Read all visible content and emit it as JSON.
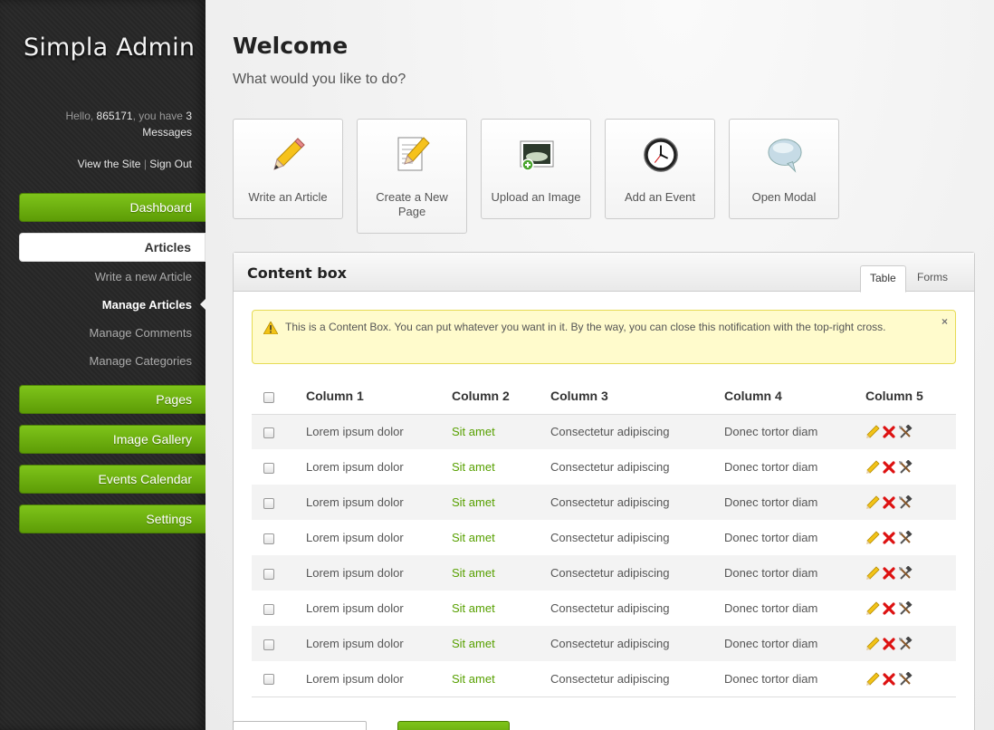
{
  "sidebar": {
    "logo": "Simpla Admin",
    "profile": {
      "hello": "Hello,",
      "username": "865171",
      "you_have": ", you have",
      "count": "3",
      "messages": "Messages"
    },
    "links": {
      "view_site": "View the Site",
      "separator": "|",
      "sign_out": "Sign Out"
    },
    "nav": [
      {
        "label": "Dashboard"
      },
      {
        "label": "Articles",
        "current": true
      },
      {
        "label": "Pages"
      },
      {
        "label": "Image Gallery"
      },
      {
        "label": "Events Calendar"
      },
      {
        "label": "Settings"
      }
    ],
    "subnav": [
      {
        "label": "Write a new Article"
      },
      {
        "label": "Manage Articles",
        "current": true
      },
      {
        "label": "Manage Comments"
      },
      {
        "label": "Manage Categories"
      }
    ]
  },
  "main": {
    "title": "Welcome",
    "subtitle": "What would you like to do?",
    "shortcuts": [
      {
        "label": "Write an Article",
        "icon": "pencil-icon"
      },
      {
        "label": "Create a New Page",
        "icon": "page-edit-icon"
      },
      {
        "label": "Upload an Image",
        "icon": "image-upload-icon"
      },
      {
        "label": "Add an Event",
        "icon": "clock-icon"
      },
      {
        "label": "Open Modal",
        "icon": "speech-bubble-icon"
      }
    ],
    "content_box": {
      "title": "Content box",
      "tabs": [
        "Table",
        "Forms"
      ],
      "active_tab": "Table",
      "notice": "This is a Content Box. You can put whatever you want in it. By the way, you can close this notification with the top-right cross.",
      "notice_close": "×",
      "columns": [
        "Column 1",
        "Column 2",
        "Column 3",
        "Column 4",
        "Column 5"
      ],
      "rows": [
        [
          "Lorem ipsum dolor",
          "Sit amet",
          "Consectetur adipiscing",
          "Donec tortor diam"
        ],
        [
          "Lorem ipsum dolor",
          "Sit amet",
          "Consectetur adipiscing",
          "Donec tortor diam"
        ],
        [
          "Lorem ipsum dolor",
          "Sit amet",
          "Consectetur adipiscing",
          "Donec tortor diam"
        ],
        [
          "Lorem ipsum dolor",
          "Sit amet",
          "Consectetur adipiscing",
          "Donec tortor diam"
        ],
        [
          "Lorem ipsum dolor",
          "Sit amet",
          "Consectetur adipiscing",
          "Donec tortor diam"
        ],
        [
          "Lorem ipsum dolor",
          "Sit amet",
          "Consectetur adipiscing",
          "Donec tortor diam"
        ],
        [
          "Lorem ipsum dolor",
          "Sit amet",
          "Consectetur adipiscing",
          "Donec tortor diam"
        ],
        [
          "Lorem ipsum dolor",
          "Sit amet",
          "Consectetur adipiscing",
          "Donec tortor diam"
        ]
      ],
      "row_actions": [
        "edit-icon",
        "delete-icon",
        "tools-icon"
      ]
    }
  },
  "colors": {
    "accent_green": "#5d9c06",
    "link_green": "#57a000",
    "notice_bg": "#fffbcc",
    "sidebar_bg": "#262626"
  }
}
